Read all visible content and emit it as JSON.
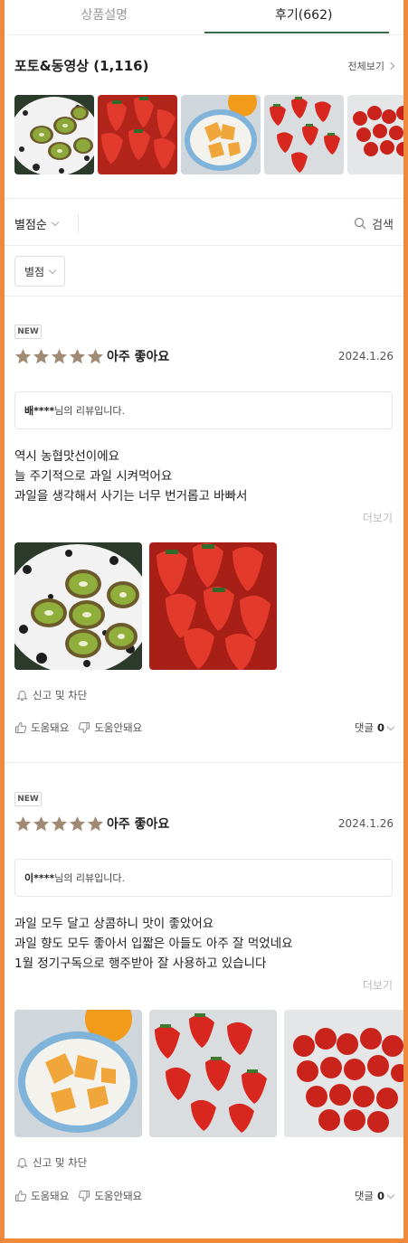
{
  "tabs": [
    {
      "label": "상품설명"
    },
    {
      "label": "후기(662)"
    }
  ],
  "photo_section": {
    "title": "포토&동영상 (1,116)",
    "see_all": "전체보기"
  },
  "sort": {
    "sort_label": "별점순",
    "search_label": "검색",
    "filter_label": "별점"
  },
  "reviews": [
    {
      "badge": "NEW",
      "rating": 5,
      "rating_label": "아주 좋아요",
      "date": "2024.1.26",
      "author": "배****",
      "author_suffix": "님의 리뷰입니다.",
      "lines": [
        "역시 농협맛선이에요",
        "늘 주기적으로 과일 시켜먹어요",
        "과일을 생각해서 사기는 너무 번거롭고 바빠서"
      ],
      "more": "더보기",
      "report": "신고 및 차단",
      "helpful": "도움돼요",
      "not_helpful": "도움안돼요",
      "comments_label": "댓글",
      "comments_count": "0"
    },
    {
      "badge": "NEW",
      "rating": 5,
      "rating_label": "아주 좋아요",
      "date": "2024.1.26",
      "author": "이****",
      "author_suffix": "님의 리뷰입니다.",
      "lines": [
        "과일 모두 달고 상콤하니 맛이 좋았어요",
        "과일 향도 모두 좋아서 입짧은 아들도 아주 잘 먹었네요",
        "1월 정기구독으로 행주받아 잘 사용하고 있습니다"
      ],
      "more": "더보기",
      "report": "신고 및 차단",
      "helpful": "도움돼요",
      "not_helpful": "도움안돼요",
      "comments_label": "댓글",
      "comments_count": "0"
    }
  ],
  "colors": {
    "frame": "#f08a3a",
    "tab_active_underline": "#3a6b4c",
    "star": "#a08a74"
  },
  "icons": [
    "chevron-right-icon",
    "chevron-down-icon",
    "search-icon",
    "star-icon",
    "bell-icon",
    "thumbs-up-icon",
    "thumbs-down-icon"
  ]
}
